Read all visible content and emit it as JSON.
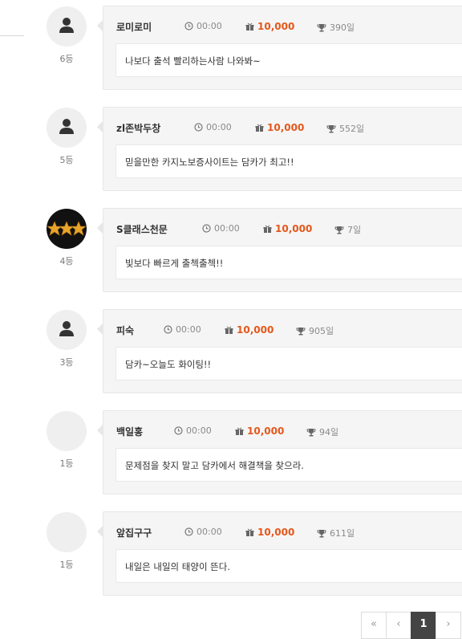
{
  "entries": [
    {
      "name": "로미로미",
      "time": "00:00",
      "points": "10,000",
      "days": "390일",
      "rank": "6등",
      "message": "나보다 출석 빨리하는사람 나와봐~",
      "avatar": "person"
    },
    {
      "name": "zl존박두창",
      "time": "00:00",
      "points": "10,000",
      "days": "552일",
      "rank": "5등",
      "message": "믿을만한 카지노보증사이트는 담카가 최고!!",
      "avatar": "person"
    },
    {
      "name": "S클래스천문",
      "time": "00:00",
      "points": "10,000",
      "days": "7일",
      "rank": "4등",
      "message": "빛보다 빠르게 출첵출첵!!",
      "avatar": "stars"
    },
    {
      "name": "피숙",
      "time": "00:00",
      "points": "10,000",
      "days": "905일",
      "rank": "3등",
      "message": "담카~오늘도 화이팅!!",
      "avatar": "person"
    },
    {
      "name": "백일홍",
      "time": "00:00",
      "points": "10,000",
      "days": "94일",
      "rank": "1등",
      "message": "문제점을 찾지 말고 담카에서 해결책을 찾으라.",
      "avatar": "blank"
    },
    {
      "name": "앞집구구",
      "time": "00:00",
      "points": "10,000",
      "days": "611일",
      "rank": "1등",
      "message": "내일은 내일의 태양이 뜬다.",
      "avatar": "blank"
    }
  ],
  "pagination": {
    "first": "«",
    "prev": "‹",
    "current": "1",
    "next": "›"
  },
  "colors": {
    "points": "#e4571b",
    "card_bg": "#f5f5f5",
    "active_page": "#444444"
  },
  "icons": {
    "time": "clock-icon",
    "points": "gift-icon",
    "days": "trophy-icon",
    "avatar": "person-icon"
  }
}
